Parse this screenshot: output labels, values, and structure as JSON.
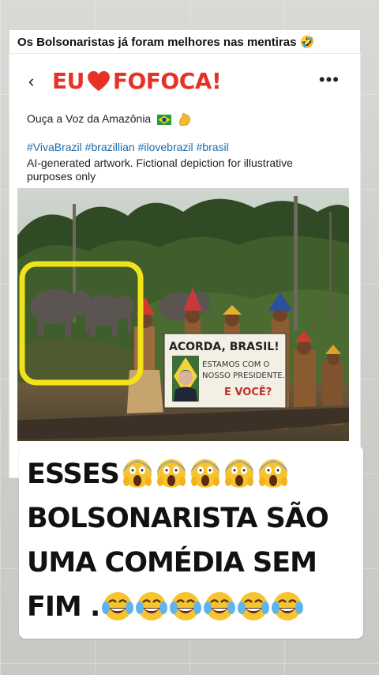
{
  "caption": {
    "text": "Os Bolsonaristas já foram melhores nas mentiras 🤣"
  },
  "header": {
    "back_glyph": "‹",
    "logo_left": "EU",
    "logo_right": "FOFOCA!",
    "more_glyph": "•••"
  },
  "post": {
    "text": "Ouça a Voz da Amazônia",
    "hashtags": "#VivaBrazil #brazillian #ilovebrazil #brasil",
    "description": "AI-generated artwork. Fictional depiction for illustrative purposes only"
  },
  "photo": {
    "sign_title": "ACORDA, BRASIL!",
    "sign_line1": "ESTAMOS COM O",
    "sign_line2": "NOSSO PRESIDENTE.",
    "sign_line3": "E VOCÊ?"
  },
  "overlay": {
    "line1": "ESSES",
    "line2": "BOLSONARISTA SÃO",
    "line3": "UMA COMÉDIA SEM",
    "line4": "FIM ."
  },
  "icons": {
    "back": "back-arrow-icon",
    "heart": "heart-icon",
    "more": "more-options-icon",
    "flag": "brazil-flag-icon",
    "muscle": "flexed-biceps-icon",
    "scream": "face-screaming-in-fear-icon",
    "laugh": "face-with-tears-of-joy-icon"
  },
  "colors": {
    "logo_red": "#e63226",
    "hashtag_blue": "#1d6aa6",
    "highlight_yellow": "#f2e21a"
  }
}
